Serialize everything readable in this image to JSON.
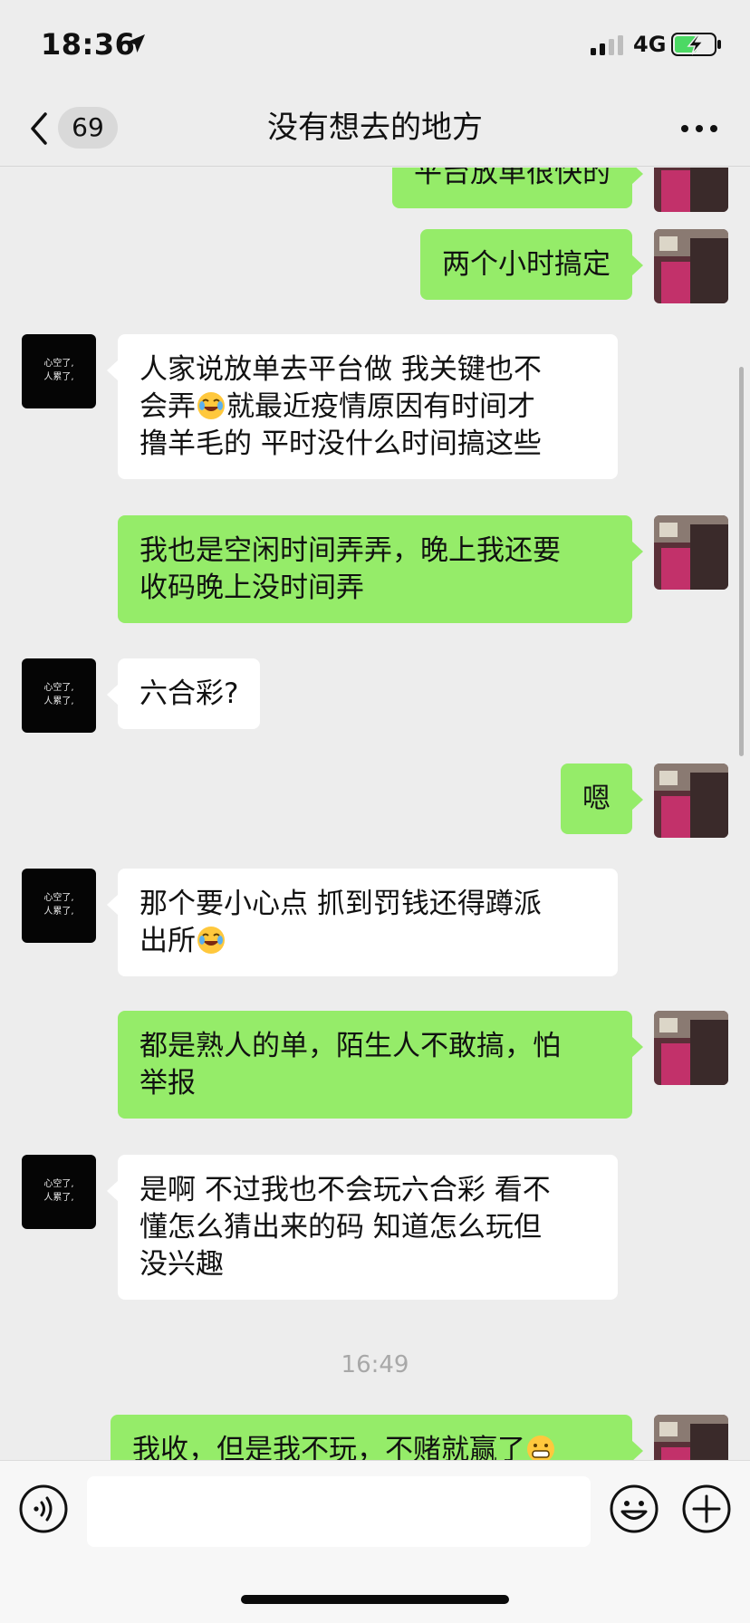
{
  "status_bar": {
    "time": "18:36",
    "network": "4G"
  },
  "nav": {
    "back_count": "69",
    "title": "没有想去的地方"
  },
  "contact_avatar": {
    "line1": "心空了,",
    "line2": "人累了,"
  },
  "messages": [
    {
      "side": "outgoing",
      "text": "平台放单很快的"
    },
    {
      "side": "outgoing",
      "text": "两个小时搞定"
    },
    {
      "side": "incoming",
      "line1": "人家说放单去平台做  我关键也不",
      "line2_a": "会弄",
      "emoji": "rolling-on-floor-laughing",
      "line2_b": "就最近疫情原因有时间才",
      "line3": "撸羊毛的  平时没什么时间搞这些"
    },
    {
      "side": "outgoing",
      "line1": "我也是空闲时间弄弄，晚上我还要",
      "line2": "收码晚上没时间弄"
    },
    {
      "side": "incoming",
      "text": "六合彩?"
    },
    {
      "side": "outgoing",
      "text": "嗯"
    },
    {
      "side": "incoming",
      "line1": "那个要小心点  抓到罚钱还得蹲派",
      "line2_a": "出所",
      "emoji": "rolling-on-floor-laughing"
    },
    {
      "side": "outgoing",
      "line1": "都是熟人的单，陌生人不敢搞，怕",
      "line2": "举报"
    },
    {
      "side": "incoming",
      "line1": "是啊 不过我也不会玩六合彩 看不",
      "line2": "懂怎么猜出来的码  知道怎么玩但",
      "line3": "没兴趣"
    },
    {
      "side": "outgoing",
      "text": "我收，但是我不玩，不赌就赢了",
      "emoji": "grinning-face"
    }
  ],
  "timestamp": "16:49",
  "input": {
    "value": "",
    "placeholder": ""
  },
  "icons": {
    "location": "location-arrow-icon",
    "signal": "cellular-signal-icon",
    "battery": "battery-charging-icon",
    "back": "chevron-left-icon",
    "more": "more-dots-icon",
    "voice": "voice-icon",
    "emoji": "emoji-icon",
    "plus": "plus-icon"
  },
  "colors": {
    "background": "#ededed",
    "outgoing_bubble": "#95ec69",
    "incoming_bubble": "#ffffff",
    "battery_charge": "#4cd964"
  }
}
